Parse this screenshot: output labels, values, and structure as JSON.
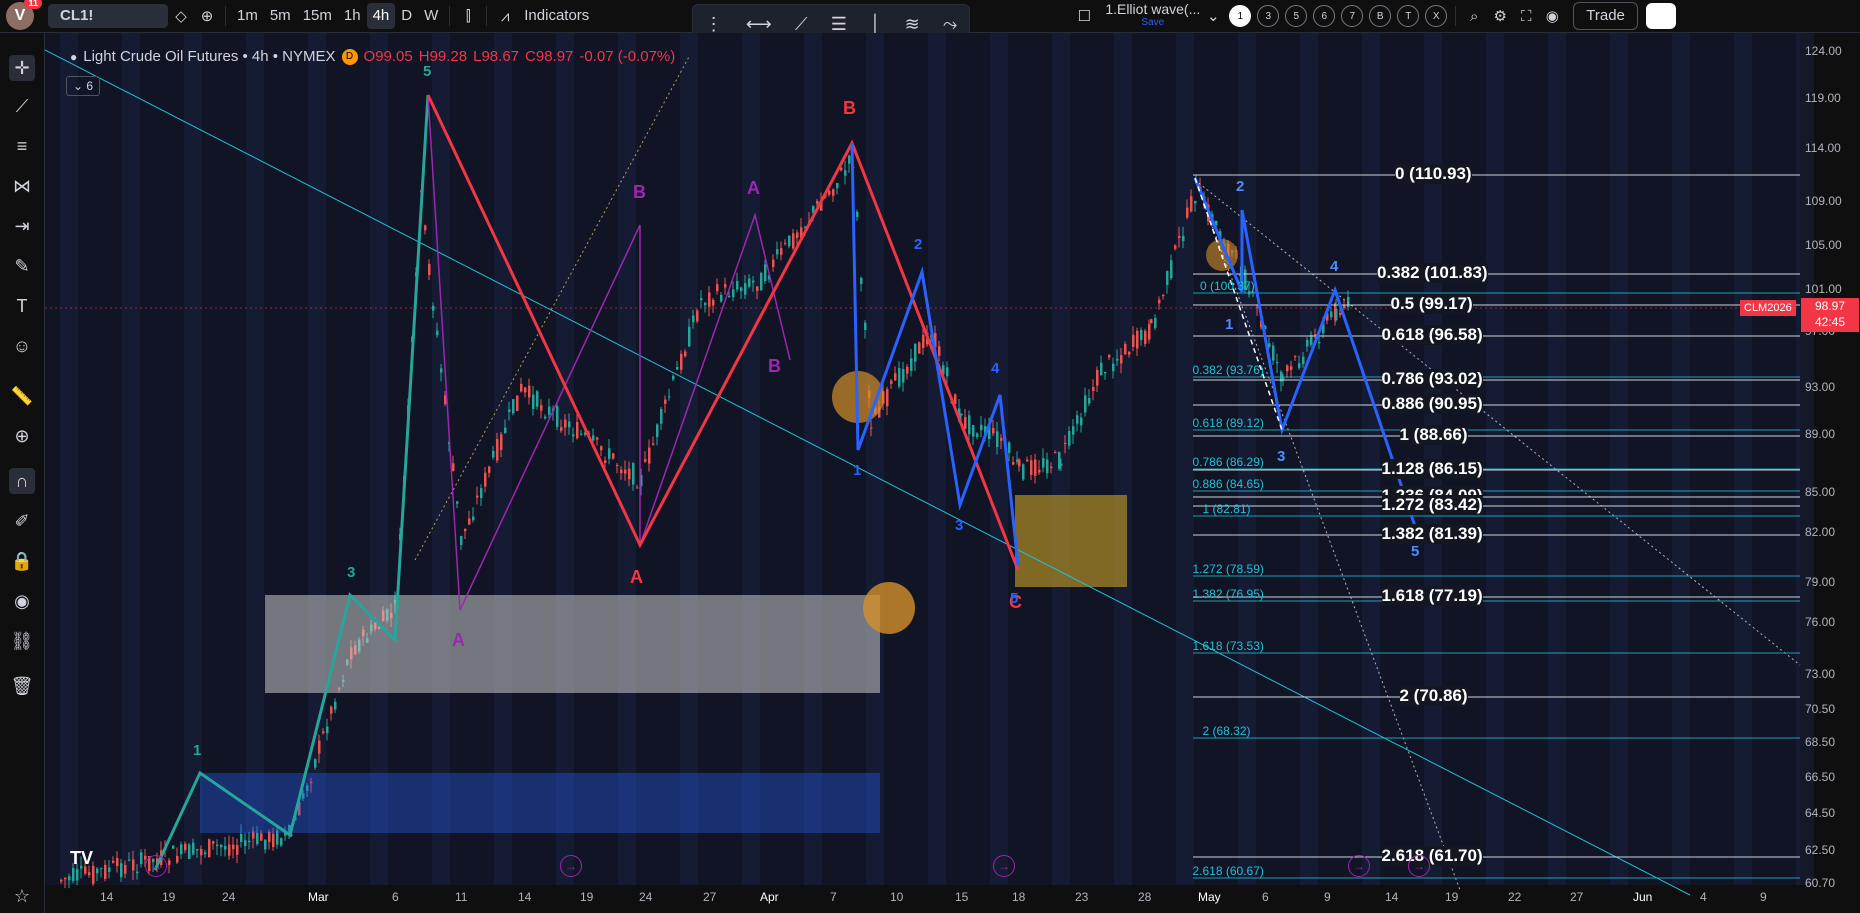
{
  "topbar": {
    "avatar_letter": "V",
    "notif_count": "11",
    "symbol": "CL1!",
    "timeframes": [
      "1m",
      "5m",
      "15m",
      "1h",
      "4h",
      "D",
      "W"
    ],
    "active_timeframe": "4h",
    "indicators_label": "Indicators",
    "layout_name": "1.Elliot wave(...",
    "layout_save": "Save",
    "tabs": [
      "1",
      "3",
      "5",
      "6",
      "7",
      "B",
      "T",
      "X"
    ],
    "active_tab": "1",
    "trade_label": "Trade"
  },
  "legend": {
    "title": "Light Crude Oil Futures • 4h • NYMEX",
    "badge": "D",
    "o": "O99.05",
    "h": "H99.28",
    "l": "L98.67",
    "c": "C98.97",
    "chg": "-0.07 (-0.07%)",
    "collapse_count": "6"
  },
  "price_axis": [
    "124.00",
    "119.00",
    "114.00",
    "109.00",
    "105.00",
    "101.00",
    "97.00",
    "93.00",
    "89.00",
    "85.00",
    "82.00",
    "79.00",
    "76.00",
    "73.00",
    "70.50",
    "68.50",
    "66.50",
    "64.50",
    "62.50",
    "60.70"
  ],
  "current_price": {
    "price": "98.97",
    "countdown": "42:45",
    "symbol": "CLM2026"
  },
  "time_axis": [
    "14",
    "19",
    "24",
    "Mar",
    "6",
    "11",
    "14",
    "19",
    "24",
    "27",
    "Apr",
    "7",
    "10",
    "15",
    "18",
    "23",
    "28",
    "May",
    "6",
    "9",
    "14",
    "19",
    "22",
    "27",
    "Jun",
    "4",
    "9"
  ],
  "fib_main": [
    "0 (110.93)",
    "0.382 (101.83)",
    "0.5 (99.17)",
    "0.618 (96.58)",
    "0.786 (93.02)",
    "0.886 (90.95)",
    "1 (88.66)",
    "1.128 (86.15)",
    "1.236 (84.09)",
    "1.272 (83.42)",
    "1.382 (81.39)",
    "1.618 (77.19)",
    "2 (70.86)",
    "2.618 (61.70)"
  ],
  "fib_secondary": [
    "0 (100.37)",
    "0.382 (93.76)",
    "0.618 (89.12)",
    "0.786 (86.29)",
    "0.886 (84.65)",
    "1 (82.81)",
    "1.272 (78.59)",
    "1.382 (76.95)",
    "1.618 (73.53)",
    "2 (68.32)",
    "2.618 (60.67)"
  ],
  "wave_labels": {
    "teal": [
      "1",
      "3",
      "5"
    ],
    "purple": [
      "A",
      "B",
      "A",
      "B"
    ],
    "red": [
      "B",
      "A",
      "C"
    ],
    "blue": [
      "1",
      "2",
      "3",
      "4",
      "5",
      "1",
      "2",
      "3",
      "4",
      "5"
    ]
  },
  "colors": {
    "teal": "#26a69a",
    "red": "#f23645",
    "blue": "#2962ff",
    "purple": "#9c27b0",
    "fibline": "#22c1d6"
  }
}
